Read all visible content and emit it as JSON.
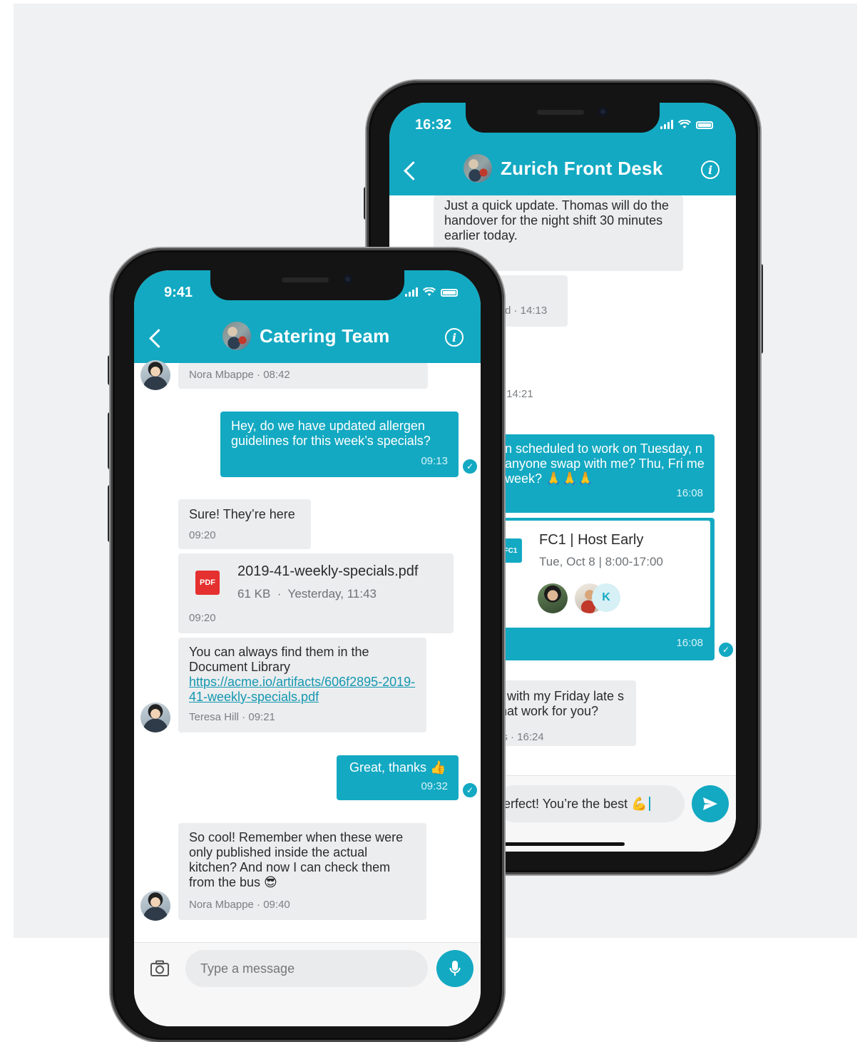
{
  "back_phone": {
    "status_time": "16:32",
    "title": "Zurich Front Desk",
    "messages": {
      "m1_text": "Just a quick update. Thomas will do the handover for the night shift 30 minutes earlier today.",
      "m2_meta": "rd · 14:13",
      "m3_meta": "· 14:21",
      "m4_text": "n scheduled to work on Tuesday, n anyone swap with me? Thu, Fri me week? 🙏🙏🙏",
      "m4_time": "16:08",
      "shift_code": "FC1",
      "shift_title": "FC1 | Host Early",
      "shift_when": "Tue, Oct 8 | 8:00-17:00",
      "shift_member_k": "K",
      "shift_time": "16:08",
      "m6_text": "p with my Friday late s that work for you?",
      "m6_meta": "ps · 16:24"
    },
    "composer_text": "erfect! You’re the best 💪"
  },
  "front_phone": {
    "status_time": "9:41",
    "title": "Catering Team",
    "messages": {
      "m0_meta": "Nora Mbappe · 08:42",
      "m1_text": "Hey, do we have updated allergen guidelines for this week’s specials?",
      "m1_time": "09:13",
      "m2_text": "Sure! They’re here",
      "m2_time": "09:20",
      "file_badge": "PDF",
      "file_name": "2019-41-weekly-specials.pdf",
      "file_info": "61 KB  ·  Yesterday, 11:43",
      "file_time": "09:20",
      "m4_text": "You can always find them in the Document Library",
      "m4_link": "https://acme.io/artifacts/606f2895-2019-41-weekly-specials.pdf",
      "m4_meta": "Teresa Hill · 09:21",
      "m5_text": "Great, thanks 👍",
      "m5_time": "09:32",
      "m6_text": "So cool! Remember when these were only published inside the actual kitchen? And now I can check them from the bus 😎",
      "m6_meta": "Nora Mbappe · 09:40"
    },
    "composer_placeholder": "Type a message"
  },
  "colors": {
    "accent": "#13a9c2",
    "bubble_in": "#ebedef",
    "pdf": "#e53030"
  },
  "icons": [
    "back-chevron-icon",
    "info-icon",
    "camera-icon",
    "microphone-icon",
    "send-icon",
    "check-icon",
    "wifi-icon",
    "battery-icon",
    "signal-icon"
  ]
}
